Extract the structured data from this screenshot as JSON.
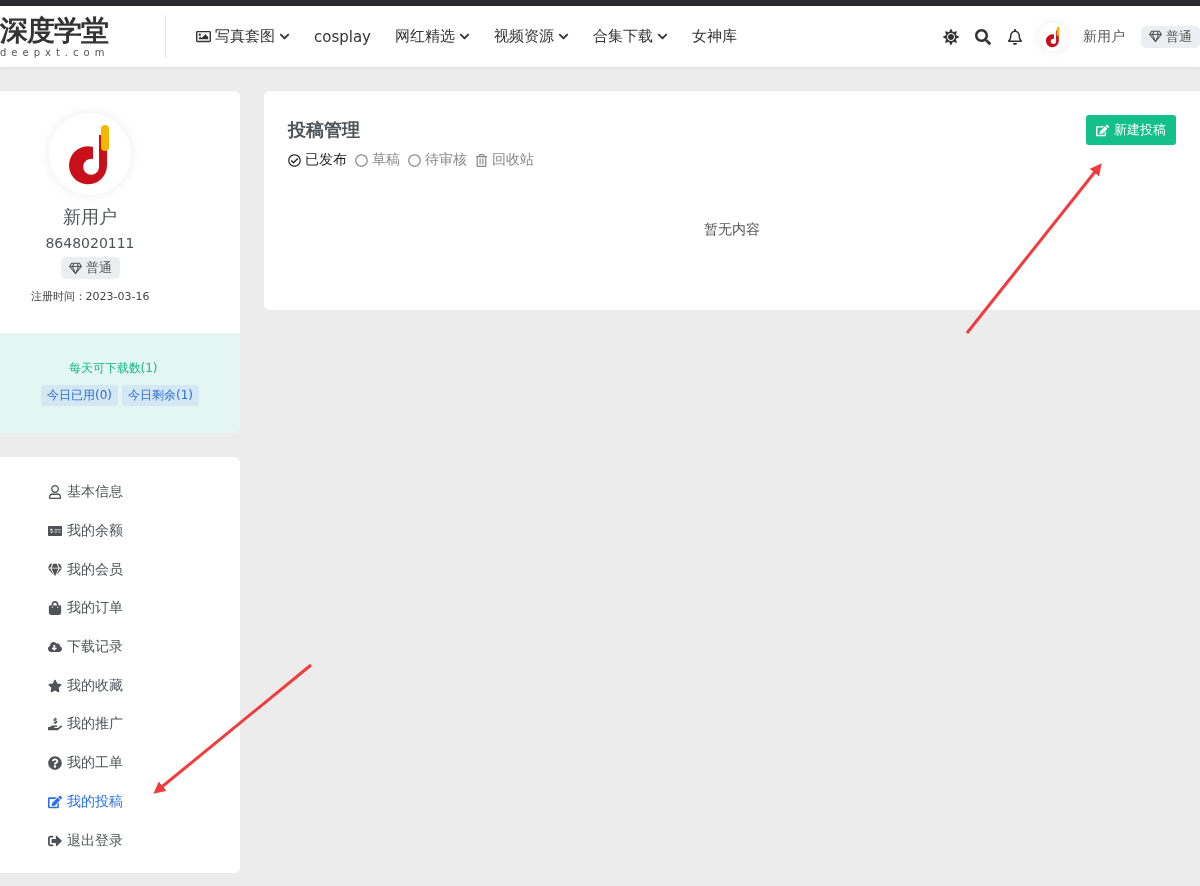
{
  "header": {
    "logo": {
      "title": "深度学堂",
      "subtitle": "deepxt.com"
    },
    "nav": [
      {
        "label": "写真套图",
        "has_icon": true,
        "has_dropdown": true
      },
      {
        "label": "cosplay",
        "has_icon": false,
        "has_dropdown": false
      },
      {
        "label": "网红精选",
        "has_icon": false,
        "has_dropdown": true
      },
      {
        "label": "视频资源",
        "has_icon": false,
        "has_dropdown": true
      },
      {
        "label": "合集下载",
        "has_icon": false,
        "has_dropdown": true
      },
      {
        "label": "女神库",
        "has_icon": false,
        "has_dropdown": false
      }
    ],
    "user": {
      "name": "新用户",
      "level": "普通"
    }
  },
  "profile": {
    "name": "新用户",
    "id": "8648020111",
    "level": "普通",
    "registered": "注册时间：2023-03-16"
  },
  "downloads": {
    "title": "每天可下载数(1)",
    "tags": [
      "今日已用(0)",
      "今日剩余(1)"
    ]
  },
  "menu": [
    {
      "label": "基本信息",
      "selected": false
    },
    {
      "label": "我的余额",
      "selected": false
    },
    {
      "label": "我的会员",
      "selected": false
    },
    {
      "label": "我的订单",
      "selected": false
    },
    {
      "label": "下载记录",
      "selected": false
    },
    {
      "label": "我的收藏",
      "selected": false
    },
    {
      "label": "我的推广",
      "selected": false
    },
    {
      "label": "我的工单",
      "selected": false
    },
    {
      "label": "我的投稿",
      "selected": true
    },
    {
      "label": "退出登录",
      "selected": false
    }
  ],
  "posts": {
    "title": "投稿管理",
    "new_button": "新建投稿",
    "tabs": [
      {
        "label": "已发布",
        "selected": true,
        "kind": "check"
      },
      {
        "label": "草稿",
        "selected": false,
        "kind": "circle"
      },
      {
        "label": "待审核",
        "selected": false,
        "kind": "circle"
      },
      {
        "label": "回收站",
        "selected": false,
        "kind": "trash"
      }
    ],
    "empty": "暂无内容"
  }
}
